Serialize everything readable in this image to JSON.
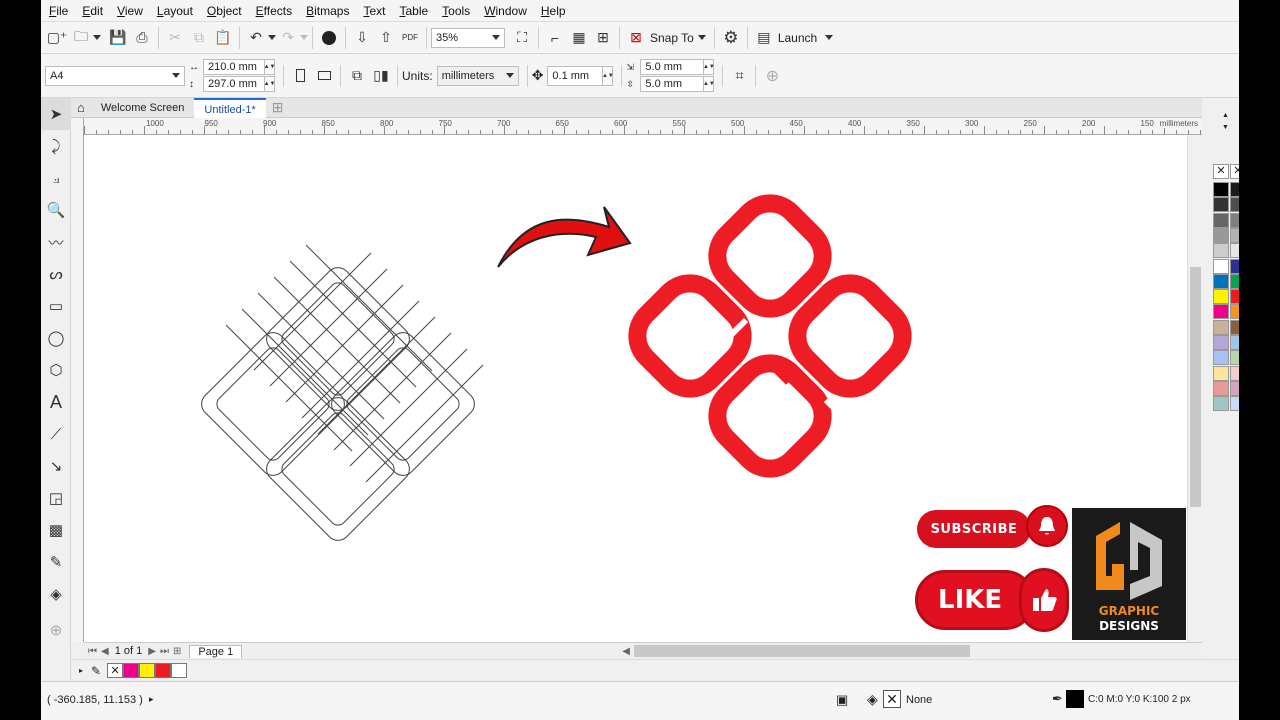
{
  "menu": [
    "File",
    "Edit",
    "View",
    "Layout",
    "Object",
    "Effects",
    "Bitmaps",
    "Text",
    "Table",
    "Tools",
    "Window",
    "Help"
  ],
  "toolbar": {
    "zoom": "35%",
    "snap_label": "Snap To",
    "launch_label": "Launch"
  },
  "propbar": {
    "page_size": "A4",
    "width": "210.0 mm",
    "height": "297.0 mm",
    "units_label": "Units:",
    "units": "millimeters",
    "nudge": "0.1 mm",
    "dup_x": "5.0 mm",
    "dup_y": "5.0 mm"
  },
  "tabs": {
    "welcome": "Welcome Screen",
    "doc": "Untitled-1*"
  },
  "ruler": {
    "ticks": [
      "1000",
      "950",
      "900",
      "850",
      "800",
      "750",
      "700",
      "650",
      "600",
      "550",
      "500",
      "450",
      "400",
      "350",
      "300",
      "250",
      "200",
      "150"
    ],
    "unit": "millimeters"
  },
  "pagebar": {
    "page_of": "1 of 1",
    "page": "Page 1"
  },
  "status": {
    "coords": "( -360.185, 11.153 )",
    "fill": "None",
    "outline": "C:0 M:0 Y:0 K:100  2 px"
  },
  "overlay": {
    "subscribe": "SUBSCRIBE",
    "like": "LIKE",
    "logo_line1": "GRAPHIC",
    "logo_line2": "DESIGNS"
  },
  "colors": {
    "knot_red": "#ee1c24",
    "accent": "#d80f1f",
    "logo_orange": "#f08a1c"
  },
  "palette_colors": [
    "#000000",
    "#1a1a1a",
    "#333333",
    "#4d4d4d",
    "#666666",
    "#808080",
    "#999999",
    "#b3b3b3",
    "#cccccc",
    "#e6e6e6",
    "#ffffff",
    "#2e3192",
    "#0072bc",
    "#00a651",
    "#fff200",
    "#ed1c24",
    "#ec008c",
    "#f7941d",
    "#c7b299",
    "#8b5e3c",
    "#b4a7d6",
    "#9fc5e8",
    "#a4c2f4",
    "#b6d7a8",
    "#ffe599",
    "#f4cccc",
    "#ea9999",
    "#d5a6bd",
    "#a2c4c9",
    "#c9daf8"
  ],
  "doc_palette": [
    "#ec008c",
    "#fff200",
    "#ed1c24",
    "#ffffff"
  ]
}
